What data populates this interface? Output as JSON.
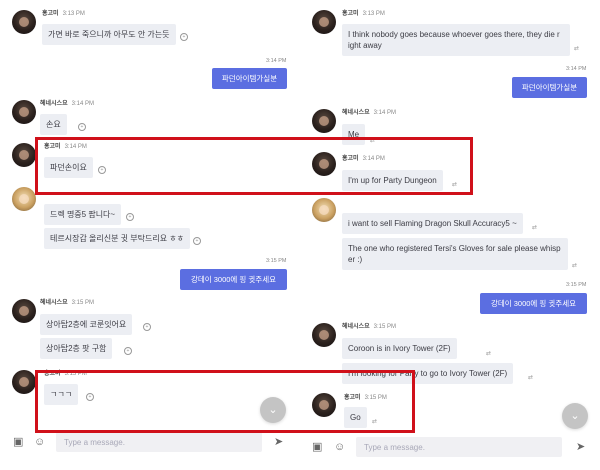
{
  "left": {
    "messages": [
      {
        "name": "홍고미",
        "time": "3:13 PM",
        "text": "가면 바로 죽으니까 아무도 안 가는듯"
      },
      {
        "time": "3:14 PM",
        "text": "파던아이템가실분"
      },
      {
        "name": "헤네시스요",
        "time": "3:14 PM",
        "text": "손요"
      },
      {
        "name": "홍고미",
        "time": "3:14 PM",
        "text": "파던손이요"
      },
      {
        "text": "드렉 명중5 팝니다~"
      },
      {
        "text": "테르시장갑 올리신분 귓 부탁드리요 ㅎㅎ"
      },
      {
        "time": "3:15 PM",
        "text": "강데이 3000에 핑 귓주세요"
      },
      {
        "name": "헤네시스요",
        "time": "3:15 PM",
        "text": "상아탑2층에 코룬잇어요"
      },
      {
        "text": "상아탑2층 팟 구함"
      },
      {
        "name": "홍고미",
        "time": "3:15 PM",
        "text": "ㄱㄱㄱ"
      }
    ],
    "placeholder": "Type a message."
  },
  "right": {
    "messages": [
      {
        "name": "홍고미",
        "time": "3:13 PM",
        "text": "I think nobody goes because whoever goes there, they die r ight away"
      },
      {
        "time": "3:14 PM",
        "text": "파던아이템가실분"
      },
      {
        "name": "헤네시스요",
        "time": "3:14 PM",
        "text": "Me"
      },
      {
        "name": "홍고미",
        "time": "3:14 PM",
        "text": "I'm up for Party Dungeon"
      },
      {
        "text": "i want to sell Flaming Dragon Skull Accuracy5 ~"
      },
      {
        "text": "The one who registered Tersi's Gloves for sale please whisp er :)"
      },
      {
        "time": "3:15 PM",
        "text": "강데이 3000에 핑 귓주세요"
      },
      {
        "name": "헤네시스요",
        "time": "3:15 PM",
        "text": "Coroon is in Ivory Tower (2F)"
      },
      {
        "text": "I'm looking for Party to go to Ivory Tower (2F)"
      },
      {
        "name": "홍고미",
        "time": "3:15 PM",
        "text": "Go"
      }
    ],
    "placeholder": "Type a message."
  },
  "icons": {
    "emoji": "emoji-add-icon",
    "translate": "translate-icon",
    "image": "image-icon",
    "smile": "smile-icon",
    "send": "send-icon",
    "scroll": "scroll-down-icon"
  },
  "colors": {
    "outgoing_bubble": "#5b6ee1",
    "incoming_bubble": "#eceef3",
    "highlight_box": "#d0101a"
  }
}
